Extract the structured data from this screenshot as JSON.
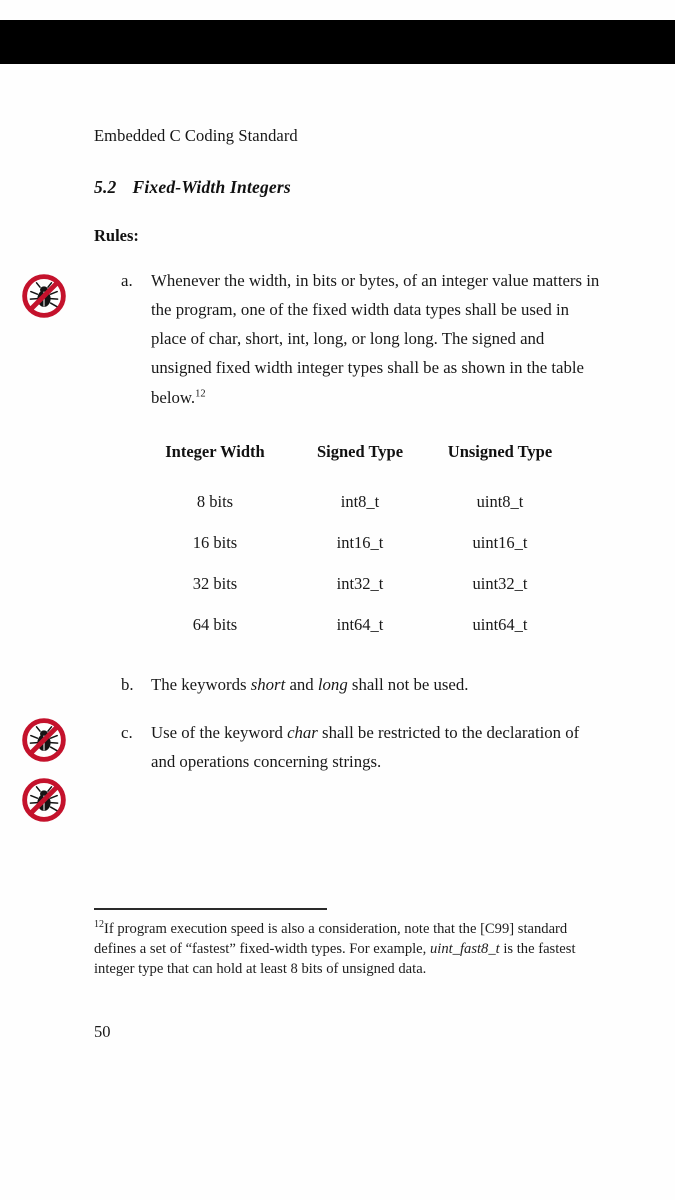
{
  "document": {
    "running_head": "Embedded C Coding Standard",
    "page_number": "50"
  },
  "section": {
    "number": "5.2",
    "title": "Fixed-Width Integers",
    "rules_label": "Rules:"
  },
  "rules": [
    {
      "marker": "a.",
      "icon": "no-bug-icon",
      "text_before_footnote": "Whenever the width, in bits or bytes, of an integer value matters in the program, one of the fixed width data types shall be used in place of char, short, int, long, or long long.  The signed and unsigned fixed width integer types shall be as shown in the table below.",
      "footnote_ref": "12"
    },
    {
      "marker": "b.",
      "icon": "no-bug-icon",
      "segments": [
        {
          "text": "The keywords ",
          "style": "normal"
        },
        {
          "text": "short",
          "style": "italic"
        },
        {
          "text": " and ",
          "style": "normal"
        },
        {
          "text": "long",
          "style": "italic"
        },
        {
          "text": " shall not be used.",
          "style": "normal"
        }
      ]
    },
    {
      "marker": "c.",
      "icon": "no-bug-icon",
      "segments": [
        {
          "text": "Use of the keyword ",
          "style": "normal"
        },
        {
          "text": "char",
          "style": "italic"
        },
        {
          "text": " shall be restricted to the declaration of and operations concerning strings.",
          "style": "normal"
        }
      ]
    }
  ],
  "table": {
    "headers": [
      "Integer Width",
      "Signed Type",
      "Unsigned Type"
    ],
    "rows": [
      [
        "8 bits",
        "int8_t",
        "uint8_t"
      ],
      [
        "16 bits",
        "int16_t",
        "uint16_t"
      ],
      [
        "32 bits",
        "int32_t",
        "uint32_t"
      ],
      [
        "64 bits",
        "int64_t",
        "uint64_t"
      ]
    ]
  },
  "footnote": {
    "marker": "12",
    "part1": "If program execution speed is also a consideration, note that the [C99] standard defines a set of “fastest” fixed-width types. For example, ",
    "italic_term": "uint_fast8_t",
    "part2": " is the fastest integer type that can hold at least 8 bits of unsigned data."
  },
  "colors": {
    "prohibition_red": "#C4122C",
    "bug_black": "#141414",
    "top_bar": "#000000",
    "page_background": "#FEFEFE",
    "text": "#191919"
  }
}
